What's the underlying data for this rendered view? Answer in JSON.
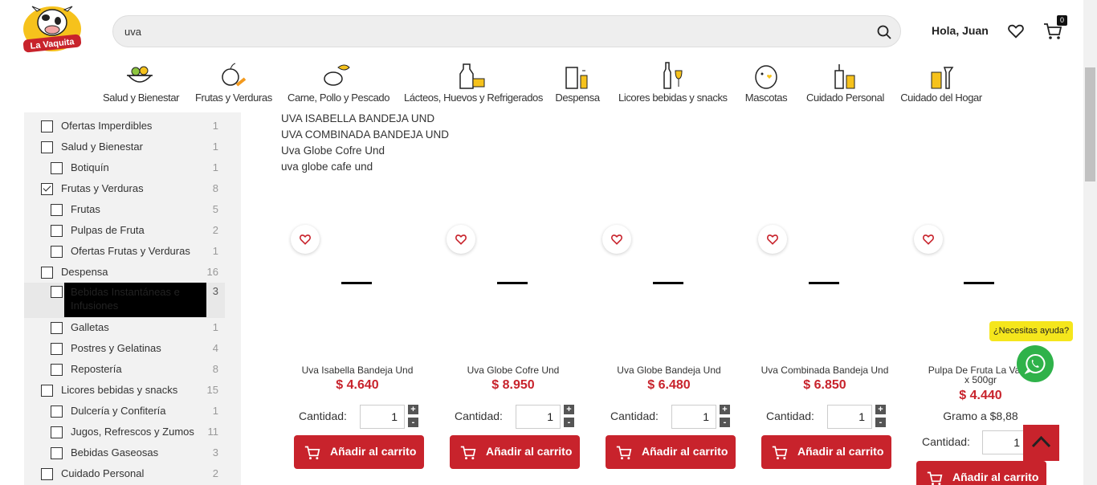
{
  "header": {
    "logo_text": "La Vaquita",
    "search_value": "uva",
    "greeting": "Hola, Juan",
    "cart_count": "0"
  },
  "categories": [
    {
      "label": "Salud y Bienestar",
      "icon": "salad-icon"
    },
    {
      "label": "Frutas y Verduras",
      "icon": "fruits-icon"
    },
    {
      "label": "Carne, Pollo y Pescado",
      "icon": "meat-fish-icon"
    },
    {
      "label": "Lácteos, Huevos y Refrigerados",
      "icon": "dairy-icon"
    },
    {
      "label": "Despensa",
      "icon": "pantry-icon"
    },
    {
      "label": "Licores bebidas y snacks",
      "icon": "liquor-icon"
    },
    {
      "label": "Mascotas",
      "icon": "pets-icon"
    },
    {
      "label": "Cuidado Personal",
      "icon": "personal-care-icon"
    },
    {
      "label": "Cuidado del Hogar",
      "icon": "home-care-icon"
    }
  ],
  "filters": [
    {
      "label": "Ofertas Imperdibles",
      "count": "1",
      "level": "top",
      "checked": false
    },
    {
      "label": "Salud y Bienestar",
      "count": "1",
      "level": "top",
      "checked": false
    },
    {
      "label": "Botiquín",
      "count": "1",
      "level": "sub",
      "checked": false
    },
    {
      "label": "Frutas y Verduras",
      "count": "8",
      "level": "top",
      "checked": true
    },
    {
      "label": "Frutas",
      "count": "5",
      "level": "sub",
      "checked": false
    },
    {
      "label": "Pulpas de Fruta",
      "count": "2",
      "level": "sub",
      "checked": false
    },
    {
      "label": "Ofertas Frutas y Verduras",
      "count": "1",
      "level": "sub",
      "checked": false
    },
    {
      "label": "Despensa",
      "count": "16",
      "level": "top",
      "checked": false
    },
    {
      "label": "Bebidas Instantáneas e Infusiones",
      "count": "3",
      "level": "sub",
      "checked": false,
      "redacted": true
    },
    {
      "label": "Galletas",
      "count": "1",
      "level": "sub",
      "checked": false
    },
    {
      "label": "Postres y Gelatinas",
      "count": "4",
      "level": "sub",
      "checked": false
    },
    {
      "label": "Repostería",
      "count": "8",
      "level": "sub",
      "checked": false
    },
    {
      "label": "Licores bebidas y snacks",
      "count": "15",
      "level": "top",
      "checked": false
    },
    {
      "label": "Dulcería y Confitería",
      "count": "1",
      "level": "sub",
      "checked": false
    },
    {
      "label": "Jugos, Refrescos y Zumos",
      "count": "11",
      "level": "sub",
      "checked": false
    },
    {
      "label": "Bebidas Gaseosas",
      "count": "3",
      "level": "sub",
      "checked": false
    },
    {
      "label": "Cuidado Personal",
      "count": "2",
      "level": "top",
      "checked": false
    }
  ],
  "suggestions": [
    "UVA ISABELLA BANDEJA UND",
    "UVA COMBINADA BANDEJA UND",
    "Uva Globe Cofre Und",
    "uva globe cafe und"
  ],
  "products": [
    {
      "name": "Uva Isabella Bandeja Und",
      "price": "$ 4.640",
      "qty": "1"
    },
    {
      "name": "Uva Globe Cofre Und",
      "price": "$ 8.950",
      "qty": "1"
    },
    {
      "name": "Uva Globe Bandeja Und",
      "price": "$ 6.480",
      "qty": "1"
    },
    {
      "name": "Uva Combinada Bandeja Und",
      "price": "$ 6.850",
      "qty": "1"
    },
    {
      "name": "Pulpa De Fruta La Vaquita x 500gr",
      "name_line1": "Pulpa De Fruta La Vaqui",
      "name_line2": "x 500gr",
      "price": "$ 4.440",
      "unit_price": "Gramo a $8,88",
      "qty": "1"
    }
  ],
  "labels": {
    "quantity": "Cantidad:",
    "add_to_cart": "Añadir al carrito",
    "plus": "+",
    "minus": "-"
  },
  "floating": {
    "help": "¿Necesitas ayuda?"
  },
  "colors": {
    "brand_red": "#c8232c",
    "whatsapp_green": "#2fb24a",
    "help_yellow": "#f5e61c"
  }
}
